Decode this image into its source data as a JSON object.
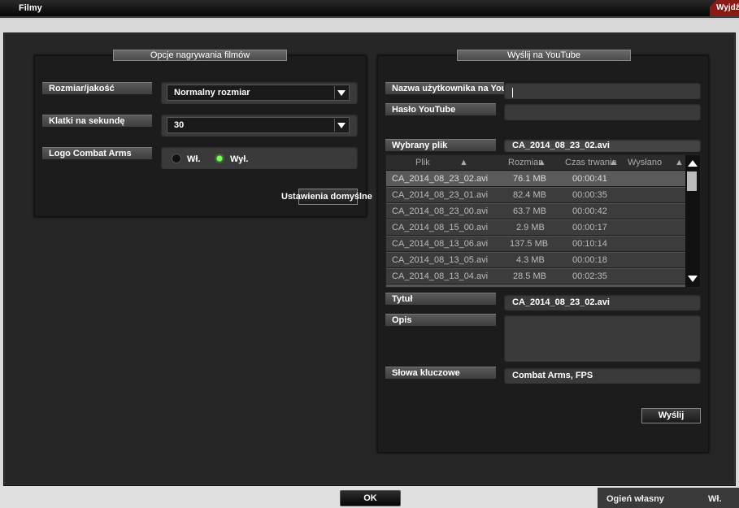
{
  "window": {
    "title": "Filmy",
    "exit_label": "Wyjdź"
  },
  "recording": {
    "header": "Opcje nagrywania filmów",
    "size_label": "Rozmiar/jakość",
    "size_value": "Normalny rozmiar",
    "fps_label": "Klatki na sekundę",
    "fps_value": "30",
    "logo_label": "Logo Combat Arms",
    "logo_on_label": "Wł.",
    "logo_off_label": "Wył.",
    "logo_selected": "off",
    "defaults_button": "Ustawienia domyślne"
  },
  "youtube": {
    "header": "Wyślij na YouTube",
    "username_label": "Nazwa użytkownika na YouTube",
    "username_value": "",
    "password_label": "Hasło YouTube",
    "password_value": "",
    "selected_file_label": "Wybrany plik",
    "selected_file_value": "CA_2014_08_23_02.avi",
    "table": {
      "columns": [
        "Plik",
        "Rozmiar",
        "Czas trwania",
        "Wysłano"
      ],
      "rows": [
        {
          "file": "CA_2014_08_23_02.avi",
          "size": "76.1 MB",
          "duration": "00:00:41",
          "sent": "",
          "selected": true
        },
        {
          "file": "CA_2014_08_23_01.avi",
          "size": "82.4 MB",
          "duration": "00:00:35",
          "sent": ""
        },
        {
          "file": "CA_2014_08_23_00.avi",
          "size": "63.7 MB",
          "duration": "00:00:42",
          "sent": ""
        },
        {
          "file": "CA_2014_08_15_00.avi",
          "size": "2.9 MB",
          "duration": "00:00:17",
          "sent": ""
        },
        {
          "file": "CA_2014_08_13_06.avi",
          "size": "137.5 MB",
          "duration": "00:10:14",
          "sent": ""
        },
        {
          "file": "CA_2014_08_13_05.avi",
          "size": "4.3 MB",
          "duration": "00:00:18",
          "sent": ""
        },
        {
          "file": "CA_2014_08_13_04.avi",
          "size": "28.5 MB",
          "duration": "00:02:35",
          "sent": ""
        }
      ]
    },
    "title_label": "Tytuł",
    "title_value": "CA_2014_08_23_02.avi",
    "description_label": "Opis",
    "description_value": "",
    "keywords_label": "Słowa kluczowe",
    "keywords_value": "Combat Arms, FPS",
    "send_button": "Wyślij"
  },
  "footer": {
    "ok_button": "OK",
    "friendly_fire_label": "Ogień własny",
    "friendly_fire_value": "Wł."
  }
}
